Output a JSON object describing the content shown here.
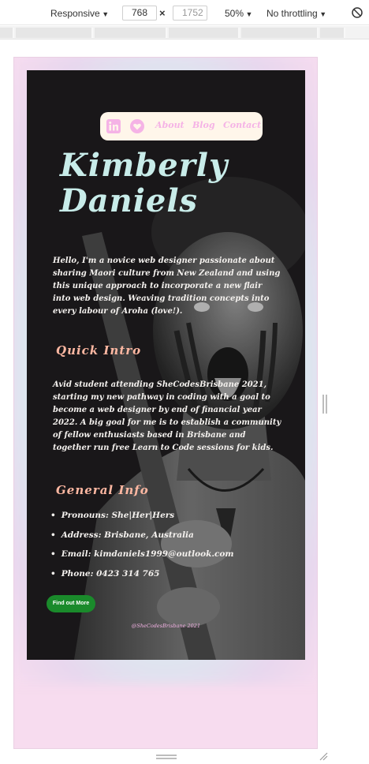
{
  "devtools": {
    "device_label": "Responsive",
    "width_value": "768",
    "separator_glyph": "×",
    "height_value": "1752",
    "zoom_label": "50%",
    "throttle_label": "No throttling",
    "rotate_icon": "rotate-icon"
  },
  "nav": {
    "linkedin_icon": "linkedin-icon",
    "heart_icon": "heart-icon",
    "links": [
      "About",
      "Blog",
      "Contact"
    ]
  },
  "hero": {
    "name_line1": "Kimberly",
    "name_line2": "Daniels"
  },
  "intro": {
    "text": "Hello, I'm a novice web designer passionate about sharing Maori culture from New Zealand and using this unique approach to incorporate a new flair into web design. Weaving tradition concepts into every labour of Aroha (love!)."
  },
  "quick_intro": {
    "title": "Quick Intro",
    "text": "Avid student attending SheCodesBrisbane 2021, starting my new pathway in coding with a goal to become a web designer by end of financial year 2022. A big goal for me is to establish a community of fellow enthusiasts based in Brisbane and together run free Learn to Code sessions for kids."
  },
  "general_info": {
    "title": "General Info",
    "items": [
      "Pronouns: She|Her|Hers",
      "Address: Brisbane, Australia",
      "Email: kimdaniels1999@outlook.com",
      "Phone: 0423 314 765"
    ]
  },
  "cta": {
    "label": "Find out More"
  },
  "footer": {
    "text": "@SheCodesBrisbane 2021"
  },
  "colors": {
    "accent_pink": "#f5b3e6",
    "name_color": "#c8ece9",
    "section_title": "#ffb8a2",
    "button_green": "#1a8a2b",
    "nav_bg": "#fff6ea",
    "page_bg": "#f7dcef"
  }
}
